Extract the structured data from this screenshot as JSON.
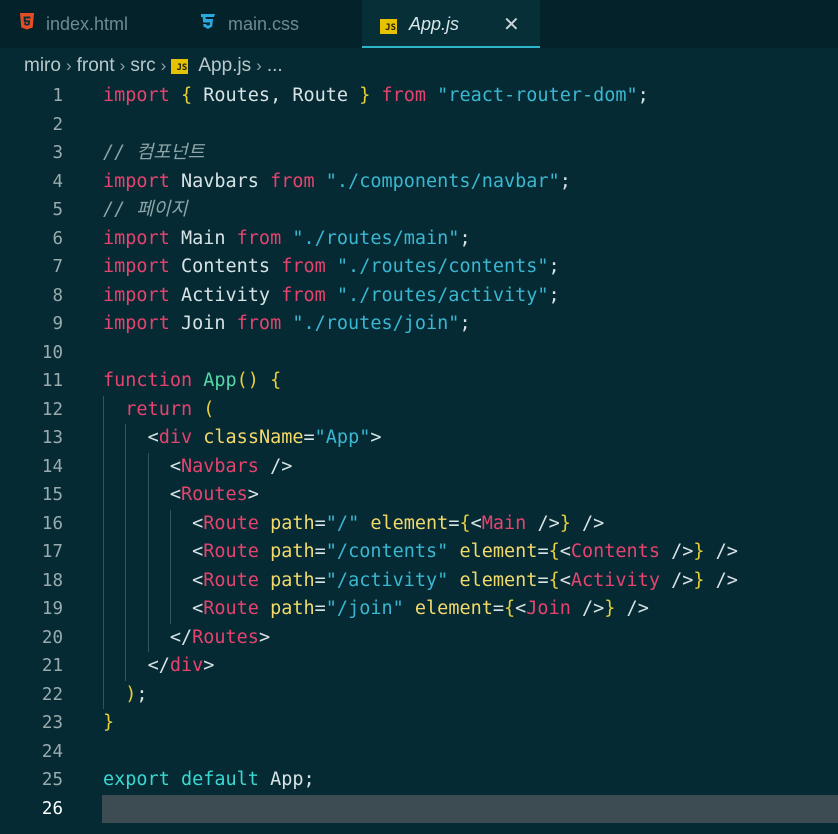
{
  "tabs": [
    {
      "label": "index.html",
      "icon": "html5-icon",
      "active": false
    },
    {
      "label": "main.css",
      "icon": "css3-icon",
      "active": false
    },
    {
      "label": "App.js",
      "icon": "js-icon",
      "active": true
    }
  ],
  "tab_close_glyph": "✕",
  "js_badge_text": "JS",
  "breadcrumb": {
    "items": [
      "miro",
      "front",
      "src",
      "App.js",
      "..."
    ],
    "separator": "›"
  },
  "current_line": 26,
  "colors": {
    "background": "#052a33",
    "keyword": "#e6436e",
    "string": "#3ab7d1",
    "bracket": "#e6cf3a",
    "function": "#57d7a7",
    "active_tab_border": "#2fb5c9"
  },
  "lines": [
    {
      "n": "1",
      "tokens": [
        {
          "t": "import",
          "c": "kw"
        },
        {
          "t": " ",
          "c": "id"
        },
        {
          "t": "{",
          "c": "br"
        },
        {
          "t": " Routes, Route ",
          "c": "id"
        },
        {
          "t": "}",
          "c": "br"
        },
        {
          "t": " ",
          "c": "id"
        },
        {
          "t": "from",
          "c": "kw"
        },
        {
          "t": " ",
          "c": "id"
        },
        {
          "t": "\"react-router-dom\"",
          "c": "str"
        },
        {
          "t": ";",
          "c": "punc"
        }
      ]
    },
    {
      "n": "2",
      "tokens": []
    },
    {
      "n": "3",
      "tokens": [
        {
          "t": "// 컴포넌트",
          "c": "cm"
        }
      ]
    },
    {
      "n": "4",
      "tokens": [
        {
          "t": "import",
          "c": "kw"
        },
        {
          "t": " Navbars ",
          "c": "id"
        },
        {
          "t": "from",
          "c": "kw"
        },
        {
          "t": " ",
          "c": "id"
        },
        {
          "t": "\"./components/navbar\"",
          "c": "str"
        },
        {
          "t": ";",
          "c": "punc"
        }
      ]
    },
    {
      "n": "5",
      "tokens": [
        {
          "t": "// 페이지",
          "c": "cm"
        }
      ]
    },
    {
      "n": "6",
      "tokens": [
        {
          "t": "import",
          "c": "kw"
        },
        {
          "t": " Main ",
          "c": "id"
        },
        {
          "t": "from",
          "c": "kw"
        },
        {
          "t": " ",
          "c": "id"
        },
        {
          "t": "\"./routes/main\"",
          "c": "str"
        },
        {
          "t": ";",
          "c": "punc"
        }
      ]
    },
    {
      "n": "7",
      "tokens": [
        {
          "t": "import",
          "c": "kw"
        },
        {
          "t": " Contents ",
          "c": "id"
        },
        {
          "t": "from",
          "c": "kw"
        },
        {
          "t": " ",
          "c": "id"
        },
        {
          "t": "\"./routes/contents\"",
          "c": "str"
        },
        {
          "t": ";",
          "c": "punc"
        }
      ]
    },
    {
      "n": "8",
      "tokens": [
        {
          "t": "import",
          "c": "kw"
        },
        {
          "t": " Activity ",
          "c": "id"
        },
        {
          "t": "from",
          "c": "kw"
        },
        {
          "t": " ",
          "c": "id"
        },
        {
          "t": "\"./routes/activity\"",
          "c": "str"
        },
        {
          "t": ";",
          "c": "punc"
        }
      ]
    },
    {
      "n": "9",
      "tokens": [
        {
          "t": "import",
          "c": "kw"
        },
        {
          "t": " Join ",
          "c": "id"
        },
        {
          "t": "from",
          "c": "kw"
        },
        {
          "t": " ",
          "c": "id"
        },
        {
          "t": "\"./routes/join\"",
          "c": "str"
        },
        {
          "t": ";",
          "c": "punc"
        }
      ]
    },
    {
      "n": "10",
      "tokens": []
    },
    {
      "n": "11",
      "tokens": [
        {
          "t": "function",
          "c": "kw"
        },
        {
          "t": " ",
          "c": "id"
        },
        {
          "t": "App",
          "c": "fn"
        },
        {
          "t": "()",
          "c": "br"
        },
        {
          "t": " ",
          "c": "id"
        },
        {
          "t": "{",
          "c": "br"
        }
      ]
    },
    {
      "n": "12",
      "tokens": [
        {
          "t": "  ",
          "c": "id"
        },
        {
          "t": "return",
          "c": "kw"
        },
        {
          "t": " ",
          "c": "id"
        },
        {
          "t": "(",
          "c": "br"
        }
      ]
    },
    {
      "n": "13",
      "tokens": [
        {
          "t": "    ",
          "c": "id"
        },
        {
          "t": "<",
          "c": "punc"
        },
        {
          "t": "div",
          "c": "tag"
        },
        {
          "t": " ",
          "c": "id"
        },
        {
          "t": "className",
          "c": "attr"
        },
        {
          "t": "=",
          "c": "punc"
        },
        {
          "t": "\"App\"",
          "c": "str"
        },
        {
          "t": ">",
          "c": "punc"
        }
      ]
    },
    {
      "n": "14",
      "tokens": [
        {
          "t": "      ",
          "c": "id"
        },
        {
          "t": "<",
          "c": "punc"
        },
        {
          "t": "Navbars",
          "c": "tag"
        },
        {
          "t": " />",
          "c": "punc"
        }
      ]
    },
    {
      "n": "15",
      "tokens": [
        {
          "t": "      ",
          "c": "id"
        },
        {
          "t": "<",
          "c": "punc"
        },
        {
          "t": "Routes",
          "c": "tag"
        },
        {
          "t": ">",
          "c": "punc"
        }
      ]
    },
    {
      "n": "16",
      "tokens": [
        {
          "t": "        ",
          "c": "id"
        },
        {
          "t": "<",
          "c": "punc"
        },
        {
          "t": "Route",
          "c": "tag"
        },
        {
          "t": " ",
          "c": "id"
        },
        {
          "t": "path",
          "c": "attr"
        },
        {
          "t": "=",
          "c": "punc"
        },
        {
          "t": "\"/\"",
          "c": "str"
        },
        {
          "t": " ",
          "c": "id"
        },
        {
          "t": "element",
          "c": "attr"
        },
        {
          "t": "=",
          "c": "punc"
        },
        {
          "t": "{",
          "c": "br"
        },
        {
          "t": "<",
          "c": "punc"
        },
        {
          "t": "Main",
          "c": "tag"
        },
        {
          "t": " />",
          "c": "punc"
        },
        {
          "t": "}",
          "c": "br"
        },
        {
          "t": " />",
          "c": "punc"
        }
      ]
    },
    {
      "n": "17",
      "tokens": [
        {
          "t": "        ",
          "c": "id"
        },
        {
          "t": "<",
          "c": "punc"
        },
        {
          "t": "Route",
          "c": "tag"
        },
        {
          "t": " ",
          "c": "id"
        },
        {
          "t": "path",
          "c": "attr"
        },
        {
          "t": "=",
          "c": "punc"
        },
        {
          "t": "\"/contents\"",
          "c": "str"
        },
        {
          "t": " ",
          "c": "id"
        },
        {
          "t": "element",
          "c": "attr"
        },
        {
          "t": "=",
          "c": "punc"
        },
        {
          "t": "{",
          "c": "br"
        },
        {
          "t": "<",
          "c": "punc"
        },
        {
          "t": "Contents",
          "c": "tag"
        },
        {
          "t": " />",
          "c": "punc"
        },
        {
          "t": "}",
          "c": "br"
        },
        {
          "t": " />",
          "c": "punc"
        }
      ]
    },
    {
      "n": "18",
      "tokens": [
        {
          "t": "        ",
          "c": "id"
        },
        {
          "t": "<",
          "c": "punc"
        },
        {
          "t": "Route",
          "c": "tag"
        },
        {
          "t": " ",
          "c": "id"
        },
        {
          "t": "path",
          "c": "attr"
        },
        {
          "t": "=",
          "c": "punc"
        },
        {
          "t": "\"/activity\"",
          "c": "str"
        },
        {
          "t": " ",
          "c": "id"
        },
        {
          "t": "element",
          "c": "attr"
        },
        {
          "t": "=",
          "c": "punc"
        },
        {
          "t": "{",
          "c": "br"
        },
        {
          "t": "<",
          "c": "punc"
        },
        {
          "t": "Activity",
          "c": "tag"
        },
        {
          "t": " />",
          "c": "punc"
        },
        {
          "t": "}",
          "c": "br"
        },
        {
          "t": " />",
          "c": "punc"
        }
      ]
    },
    {
      "n": "19",
      "tokens": [
        {
          "t": "        ",
          "c": "id"
        },
        {
          "t": "<",
          "c": "punc"
        },
        {
          "t": "Route",
          "c": "tag"
        },
        {
          "t": " ",
          "c": "id"
        },
        {
          "t": "path",
          "c": "attr"
        },
        {
          "t": "=",
          "c": "punc"
        },
        {
          "t": "\"/join\"",
          "c": "str"
        },
        {
          "t": " ",
          "c": "id"
        },
        {
          "t": "element",
          "c": "attr"
        },
        {
          "t": "=",
          "c": "punc"
        },
        {
          "t": "{",
          "c": "br"
        },
        {
          "t": "<",
          "c": "punc"
        },
        {
          "t": "Join",
          "c": "tag"
        },
        {
          "t": " />",
          "c": "punc"
        },
        {
          "t": "}",
          "c": "br"
        },
        {
          "t": " />",
          "c": "punc"
        }
      ]
    },
    {
      "n": "20",
      "tokens": [
        {
          "t": "      ",
          "c": "id"
        },
        {
          "t": "</",
          "c": "punc"
        },
        {
          "t": "Routes",
          "c": "tag"
        },
        {
          "t": ">",
          "c": "punc"
        }
      ]
    },
    {
      "n": "21",
      "tokens": [
        {
          "t": "    ",
          "c": "id"
        },
        {
          "t": "</",
          "c": "punc"
        },
        {
          "t": "div",
          "c": "tag"
        },
        {
          "t": ">",
          "c": "punc"
        }
      ]
    },
    {
      "n": "22",
      "tokens": [
        {
          "t": "  ",
          "c": "id"
        },
        {
          "t": ")",
          "c": "br"
        },
        {
          "t": ";",
          "c": "punc"
        }
      ]
    },
    {
      "n": "23",
      "tokens": [
        {
          "t": "}",
          "c": "br"
        }
      ]
    },
    {
      "n": "24",
      "tokens": []
    },
    {
      "n": "25",
      "tokens": [
        {
          "t": "export",
          "c": "kw2"
        },
        {
          "t": " ",
          "c": "id"
        },
        {
          "t": "default",
          "c": "kw2"
        },
        {
          "t": " App",
          "c": "id"
        },
        {
          "t": ";",
          "c": "punc"
        }
      ]
    },
    {
      "n": "26",
      "tokens": []
    }
  ]
}
